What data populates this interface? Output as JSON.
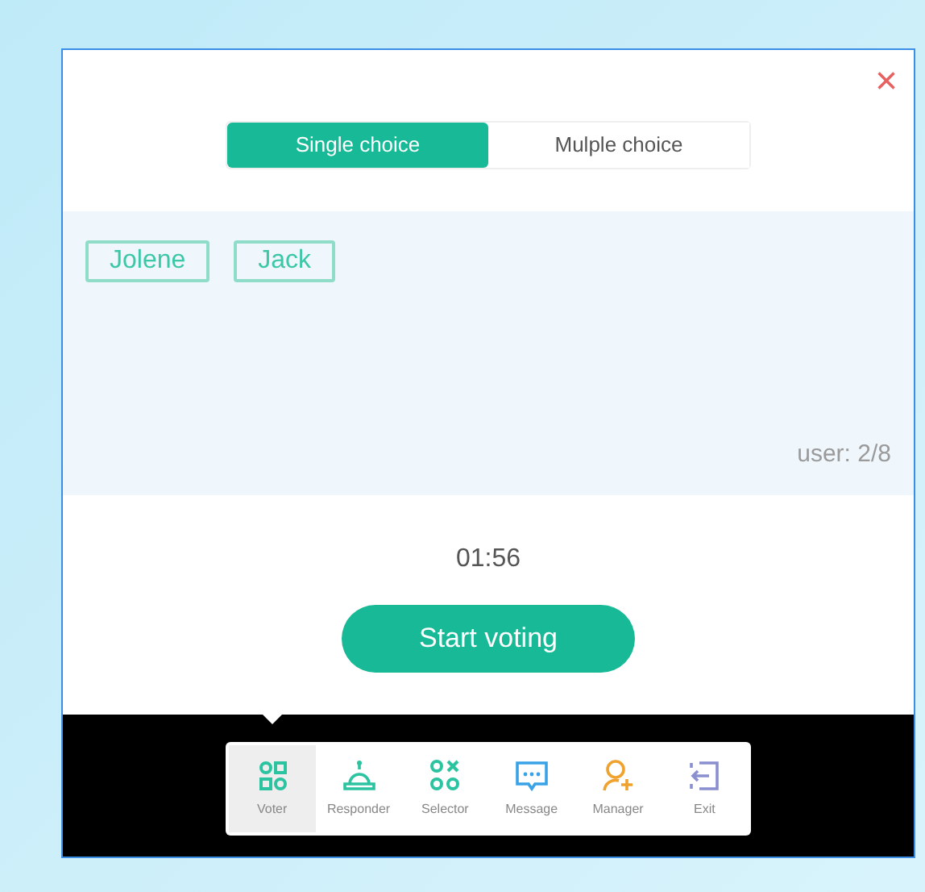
{
  "close": "×",
  "tabs": [
    {
      "label": "Single choice",
      "selected": true
    },
    {
      "label": "Mulple choice",
      "selected": false
    }
  ],
  "participants": [
    "Jolene",
    "Jack"
  ],
  "user_count": "user: 2/8",
  "timer": "01:56",
  "start_button": "Start voting",
  "toolbar": [
    {
      "label": "Voter",
      "kind": "voter",
      "selected": true
    },
    {
      "label": "Responder",
      "kind": "responder",
      "selected": false
    },
    {
      "label": "Selector",
      "kind": "selector",
      "selected": false
    },
    {
      "label": "Message",
      "kind": "message",
      "selected": false
    },
    {
      "label": "Manager",
      "kind": "manager",
      "selected": false
    },
    {
      "label": "Exit",
      "kind": "exit",
      "selected": false
    }
  ]
}
